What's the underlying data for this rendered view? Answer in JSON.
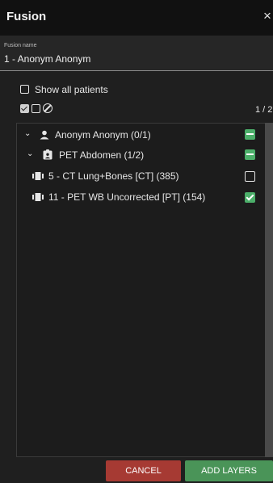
{
  "dialog": {
    "title": "Fusion",
    "close_glyph": "×"
  },
  "fusion_name": {
    "label": "Fusion name",
    "value": "1 - Anonym Anonym"
  },
  "options": {
    "show_all_patients_label": "Show all patients",
    "show_all_patients_checked": false,
    "selection_count": "1 / 2"
  },
  "tree": {
    "patient": {
      "label": "Anonym Anonym (0/1)",
      "state": "partial",
      "expanded": true,
      "icon": "person-icon"
    },
    "study": {
      "label": "PET Abdomen (1/2)",
      "state": "partial",
      "expanded": true,
      "icon": "study-badge-icon"
    },
    "series": [
      {
        "label": "5 - CT Lung+Bones [CT] (385)",
        "state": "unchecked",
        "icon": "series-icon"
      },
      {
        "label": "11 - PET WB Uncorrected [PT] (154)",
        "state": "checked",
        "icon": "series-icon"
      }
    ]
  },
  "footer": {
    "cancel_label": "CANCEL",
    "add_label": "ADD LAYERS"
  },
  "colors": {
    "accent_green": "#4caf6a",
    "cancel_red": "#a63a33",
    "add_green": "#4a9458",
    "background": "#1f1f1f"
  }
}
